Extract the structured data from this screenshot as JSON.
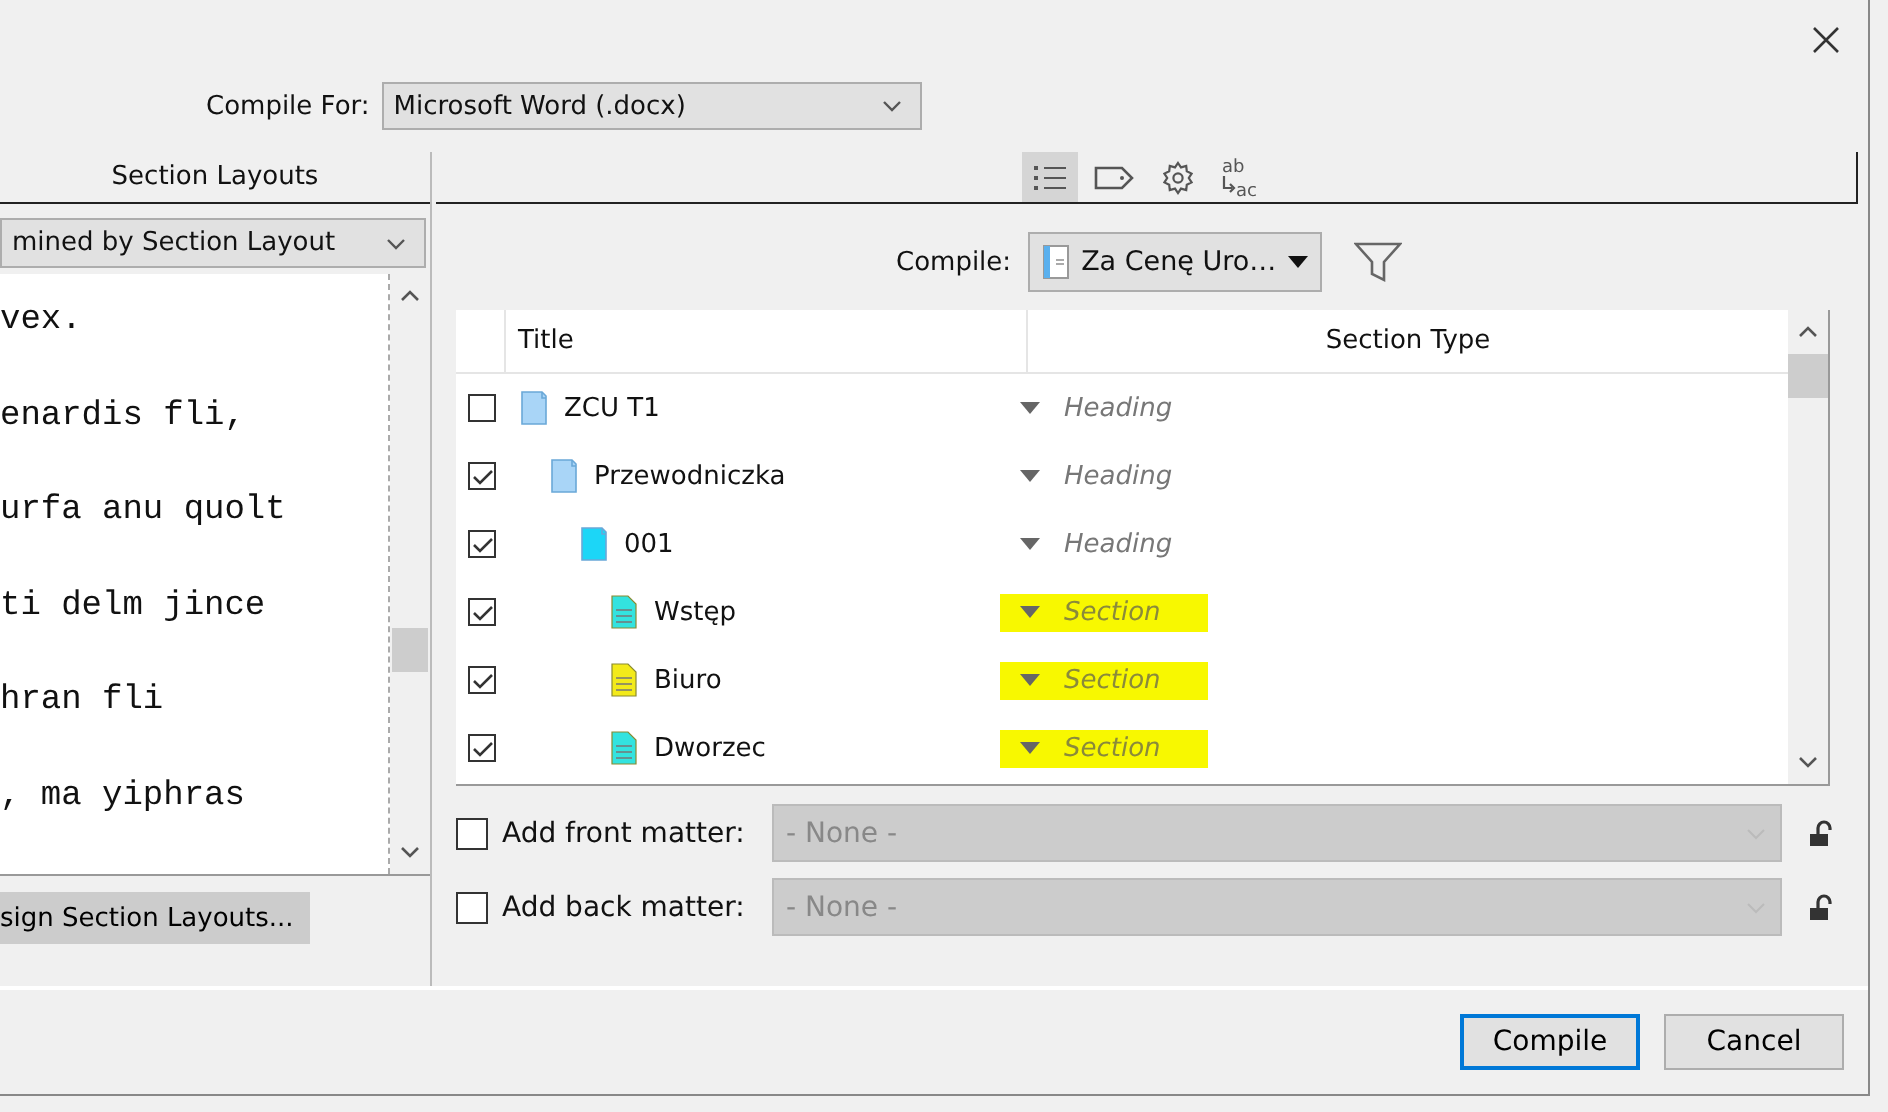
{
  "compile_for": {
    "label": "Compile For:",
    "value": "Microsoft Word (.docx)"
  },
  "left_panel": {
    "header": "Section Layouts",
    "layout_dropdown": "mined by Section Layout",
    "editor_lines": [
      "vex.",
      "enardis fli,",
      "urfa anu quolt",
      "ti delm jince",
      "hran fli",
      ", ma yiphras"
    ],
    "assign_button": "sign Section Layouts..."
  },
  "toolbar": [
    {
      "kind": "list",
      "selected": true
    },
    {
      "kind": "tag",
      "selected": false
    },
    {
      "kind": "gear",
      "selected": false
    },
    {
      "kind": "replace",
      "selected": false,
      "top": "ab",
      "bottom": "ac"
    }
  ],
  "compile_scope": {
    "label": "Compile:",
    "value": "Za Cenę Uro…"
  },
  "table": {
    "columns": [
      "Title",
      "Section Type"
    ],
    "rows": [
      {
        "title": "ZCU T1",
        "checked": false,
        "kind": "folder",
        "color": "#a9d5f7",
        "section_type": "Heading",
        "highlighted": false,
        "children": [
          {
            "title": "Przewodniczka",
            "checked": true,
            "kind": "folder",
            "color": "#a9d5f7",
            "section_type": "Heading",
            "highlighted": false,
            "children": [
              {
                "title": "001",
                "checked": true,
                "kind": "folder",
                "color": "#1cd6f7",
                "section_type": "Heading",
                "highlighted": false,
                "children": [
                  {
                    "title": "Wstęp",
                    "checked": true,
                    "kind": "document",
                    "color": "#33e3df",
                    "section_type": "Section",
                    "highlighted": true
                  },
                  {
                    "title": "Biuro",
                    "checked": true,
                    "kind": "document",
                    "color": "#f3ea1a",
                    "section_type": "Section",
                    "highlighted": true
                  },
                  {
                    "title": "Dworzec",
                    "checked": true,
                    "kind": "document",
                    "color": "#33e3df",
                    "section_type": "Section",
                    "highlighted": true
                  }
                ]
              }
            ]
          }
        ]
      }
    ]
  },
  "matter": [
    {
      "label": "Add front matter:",
      "checked": false,
      "value": "- None -"
    },
    {
      "label": "Add back matter:",
      "checked": false,
      "value": "- None -"
    }
  ],
  "buttons": [
    {
      "label": "Compile",
      "default": true
    },
    {
      "label": "Cancel",
      "default": false
    }
  ]
}
